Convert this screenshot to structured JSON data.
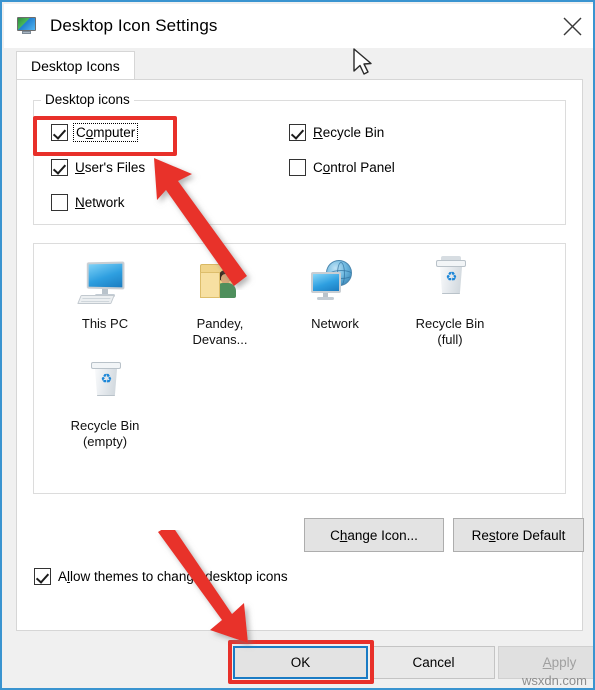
{
  "window": {
    "title": "Desktop Icon Settings",
    "icon": "monitor-icon",
    "close_label": "close-icon",
    "border_color": "#3a94d0"
  },
  "tabs": [
    {
      "label": "Desktop Icons",
      "selected": true
    }
  ],
  "desktop_icons_group": {
    "legend": "Desktop icons",
    "checkboxes": [
      {
        "name": "computer",
        "label_pre": "C",
        "label_accel": "o",
        "label_post": "mputer",
        "label": "Computer",
        "checked": true,
        "focused": true
      },
      {
        "name": "users-files",
        "label_pre": "",
        "label_accel": "U",
        "label_post": "ser's Files",
        "label": "User's Files",
        "checked": true,
        "focused": false
      },
      {
        "name": "network",
        "label_pre": "",
        "label_accel": "N",
        "label_post": "etwork",
        "label": "Network",
        "checked": false,
        "focused": false
      },
      {
        "name": "recycle-bin",
        "label_pre": "",
        "label_accel": "R",
        "label_post": "ecycle Bin",
        "label": "Recycle Bin",
        "checked": true,
        "focused": false
      },
      {
        "name": "control-panel",
        "label_pre": "C",
        "label_accel": "o",
        "label_post": "ntrol Panel",
        "label": "Control Panel",
        "checked": false,
        "focused": false
      }
    ]
  },
  "preview": {
    "items": [
      {
        "name": "this-pc",
        "caption_line1": "This PC",
        "caption_line2": "",
        "icon": "monitor-icon"
      },
      {
        "name": "user-folder",
        "caption_line1": "Pandey,",
        "caption_line2": "Devans...",
        "icon": "user-folder-icon"
      },
      {
        "name": "network",
        "caption_line1": "Network",
        "caption_line2": "",
        "icon": "network-globe-icon"
      },
      {
        "name": "recycle-bin-full",
        "caption_line1": "Recycle Bin",
        "caption_line2": "(full)",
        "icon": "recycle-bin-full-icon"
      },
      {
        "name": "recycle-bin-empty",
        "caption_line1": "Recycle Bin",
        "caption_line2": "(empty)",
        "icon": "recycle-bin-empty-icon"
      }
    ]
  },
  "buttons": {
    "change_icon": {
      "pre": "C",
      "accel": "h",
      "post": "ange Icon...",
      "label": "Change Icon..."
    },
    "restore_default": {
      "pre": "Re",
      "accel": "s",
      "post": "tore Default",
      "label": "Restore Default"
    },
    "ok": {
      "label": "OK",
      "focused": true
    },
    "cancel": {
      "label": "Cancel"
    },
    "apply": {
      "pre": "",
      "accel": "A",
      "post": "pply",
      "label": "Apply",
      "disabled": true
    }
  },
  "allow_themes": {
    "label": "Allow themes to change desktop icons",
    "label_pre": "A",
    "label_accel": "l",
    "label_post": "low themes to change desktop icons",
    "checked": true
  },
  "annotations": {
    "highlight_color": "#e8302a",
    "focus_color": "#1a7bc4",
    "arrow_1_target": "computer-checkbox",
    "arrow_2_target": "ok-button"
  },
  "watermark": {
    "text": "wsxdn.com"
  }
}
